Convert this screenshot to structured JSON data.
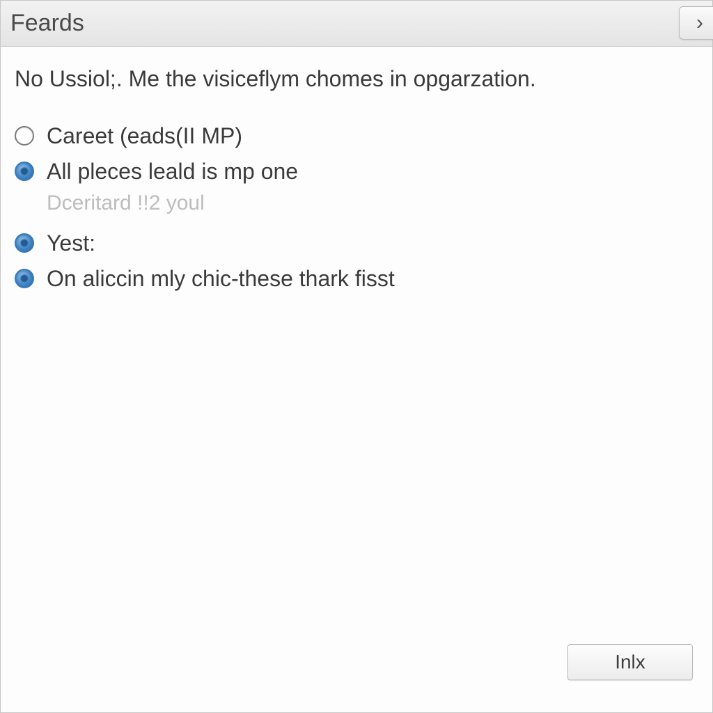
{
  "titlebar": {
    "title": "Feards",
    "close_glyph": "›"
  },
  "description": "No Ussiol;. Me the visiceflym chomes in opgarzation.",
  "options": [
    {
      "label": "Careet (eads(II MP)",
      "checked": false,
      "subtext": null
    },
    {
      "label": "All pleces leald is mp one",
      "checked": true,
      "subtext": "Dceritard !!2 youl"
    },
    {
      "label": "Yest:",
      "checked": true,
      "subtext": null
    },
    {
      "label": "On aliccin mly chic-these thark fisst",
      "checked": true,
      "subtext": null
    }
  ],
  "footer": {
    "action_label": "Inlx"
  }
}
